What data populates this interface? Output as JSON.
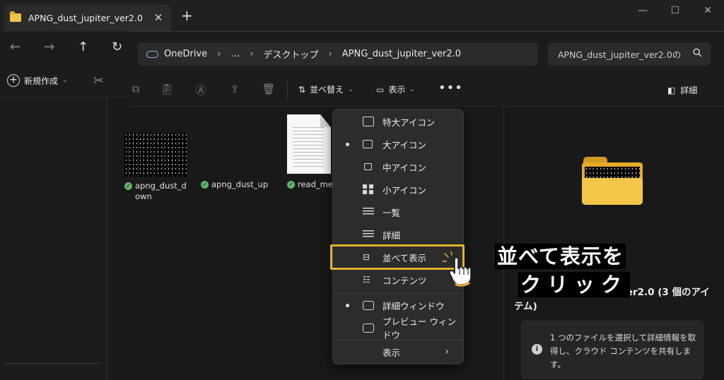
{
  "back_window": {
    "tab_title": "APNG_dust_jupiter_ver2.0",
    "tab_close": "✕",
    "new_tab": "+",
    "win_controls": [
      "—",
      "☐",
      "✕"
    ],
    "nav": [
      "←",
      "→",
      "↑",
      "↻"
    ],
    "new_button_label": "新規作成",
    "cut_icon": "✂"
  },
  "address_bar": {
    "crumbs": [
      "OneDrive",
      "…",
      "デスクトップ",
      "APNG_dust_jupiter_ver2.0"
    ],
    "separator": "›"
  },
  "search": {
    "placeholder": "APNG_dust_jupiter_ver2.0の",
    "icon": "🔍"
  },
  "toolbar": {
    "sort_label": "並べ替え",
    "view_label": "表示",
    "more_label": "•••",
    "details_label": "詳細"
  },
  "files": [
    {
      "name": "apng_dust_down"
    },
    {
      "name": "apng_dust_up"
    },
    {
      "name": "read_me"
    }
  ],
  "preview": {
    "title": "ver2.0 (3 個のアイテム)",
    "info_icon": "i",
    "info_text": "1 つのファイルを選択して詳細情報を取得し、クラウド コンテンツを共有します。"
  },
  "view_menu": {
    "items": [
      {
        "label": "特大アイコン",
        "selected": false,
        "icon": "extra-large-icons-icon"
      },
      {
        "label": "大アイコン",
        "selected": true,
        "icon": "large-icons-icon"
      },
      {
        "label": "中アイコン",
        "selected": false,
        "icon": "medium-icons-icon"
      },
      {
        "label": "小アイコン",
        "selected": false,
        "icon": "small-icons-icon"
      },
      {
        "label": "一覧",
        "selected": false,
        "icon": "list-icon"
      },
      {
        "label": "詳細",
        "selected": false,
        "icon": "details-icon"
      },
      {
        "label": "並べて表示",
        "selected": false,
        "icon": "tiles-icon",
        "highlighted": true
      },
      {
        "label": "コンテンツ",
        "selected": false,
        "icon": "content-icon"
      },
      {
        "label": "詳細ウィンドウ",
        "selected": true,
        "icon": "details-pane-icon"
      },
      {
        "label": "プレビュー ウィンドウ",
        "selected": false,
        "icon": "preview-pane-icon"
      },
      {
        "label": "表示",
        "selected": false,
        "submenu": true
      }
    ],
    "submenu_arrow": "›"
  },
  "caption": {
    "line1": "並べて表示を",
    "line2": "クリック"
  },
  "colors": {
    "highlight": "#e0b22b",
    "background": "#191919",
    "menu": "#2c2c2c"
  }
}
